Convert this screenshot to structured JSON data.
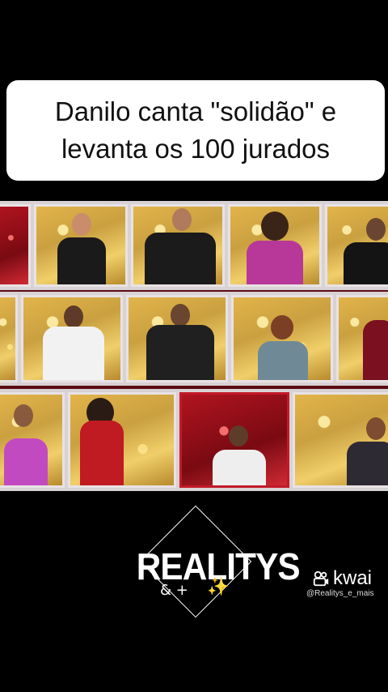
{
  "caption": {
    "line1": "Danilo canta \"solidão\" e",
    "line2": "levanta os 100 jurados"
  },
  "watermark": {
    "brand": "REALITYS",
    "brand_sub": "& +",
    "sparkle": "✨",
    "app_name": "kwai",
    "handle": "@Realitys_e_mais"
  },
  "colors": {
    "background": "#000000",
    "caption_bg": "#ffffff",
    "panel_gold": "#d8ad47",
    "panel_red": "#b0141f"
  }
}
